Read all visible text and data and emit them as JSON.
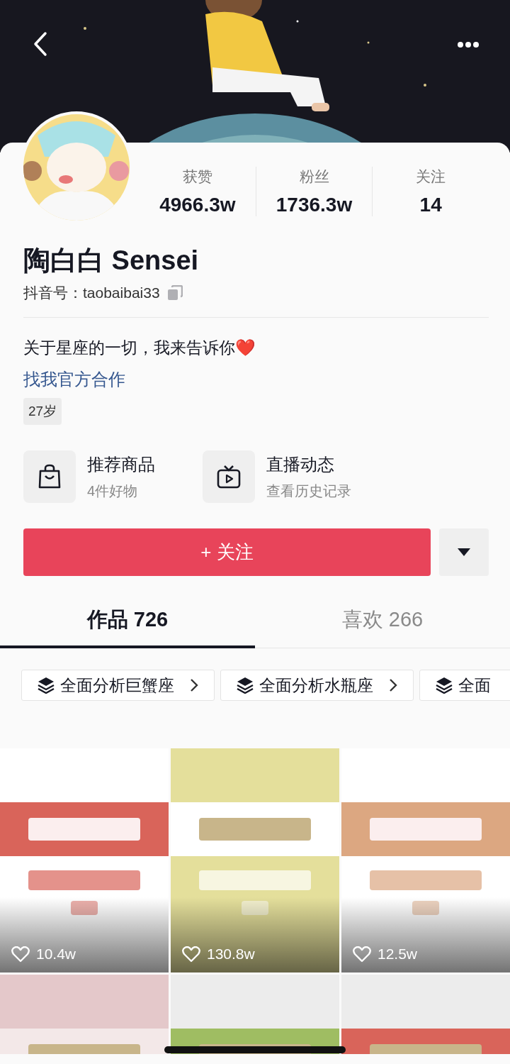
{
  "header": {
    "kind": "picture"
  },
  "avatar": {
    "kind": "picture"
  },
  "stats": [
    {
      "label": "获赞",
      "value": "4966.3w"
    },
    {
      "label": "粉丝",
      "value": "1736.3w"
    },
    {
      "label": "关注",
      "value": "14"
    }
  ],
  "profile": {
    "name": "陶白白 Sensei",
    "account": "抖音号：taobaibai33",
    "bio": "关于星座的一切，我来告诉你❤️",
    "link": "找我官方合作",
    "age": "27岁"
  },
  "services": [
    {
      "kind": "shop",
      "title": "推荐商品",
      "subtitle": "4件好物"
    },
    {
      "kind": "live",
      "title": "直播动态",
      "subtitle": "查看历史记录"
    }
  ],
  "follow_button": "+ 关注",
  "tabs": [
    {
      "label": "作品 726",
      "selected": true
    },
    {
      "label": "喜欢 266",
      "selected": false
    }
  ],
  "collections": [
    {
      "title": "全面分析巨蟹座",
      "cut_off": false
    },
    {
      "title": "全面分析水瓶座",
      "cut_off": false
    },
    {
      "title": "全面",
      "cut_off": true
    }
  ],
  "videos": [
    {
      "kind": "picture",
      "likes": "10.4w"
    },
    {
      "kind": "picture",
      "likes": "130.8w"
    },
    {
      "kind": "picture",
      "likes": "12.5w"
    },
    {
      "kind": "picture"
    },
    {
      "kind": "picture"
    },
    {
      "kind": "picture"
    }
  ]
}
